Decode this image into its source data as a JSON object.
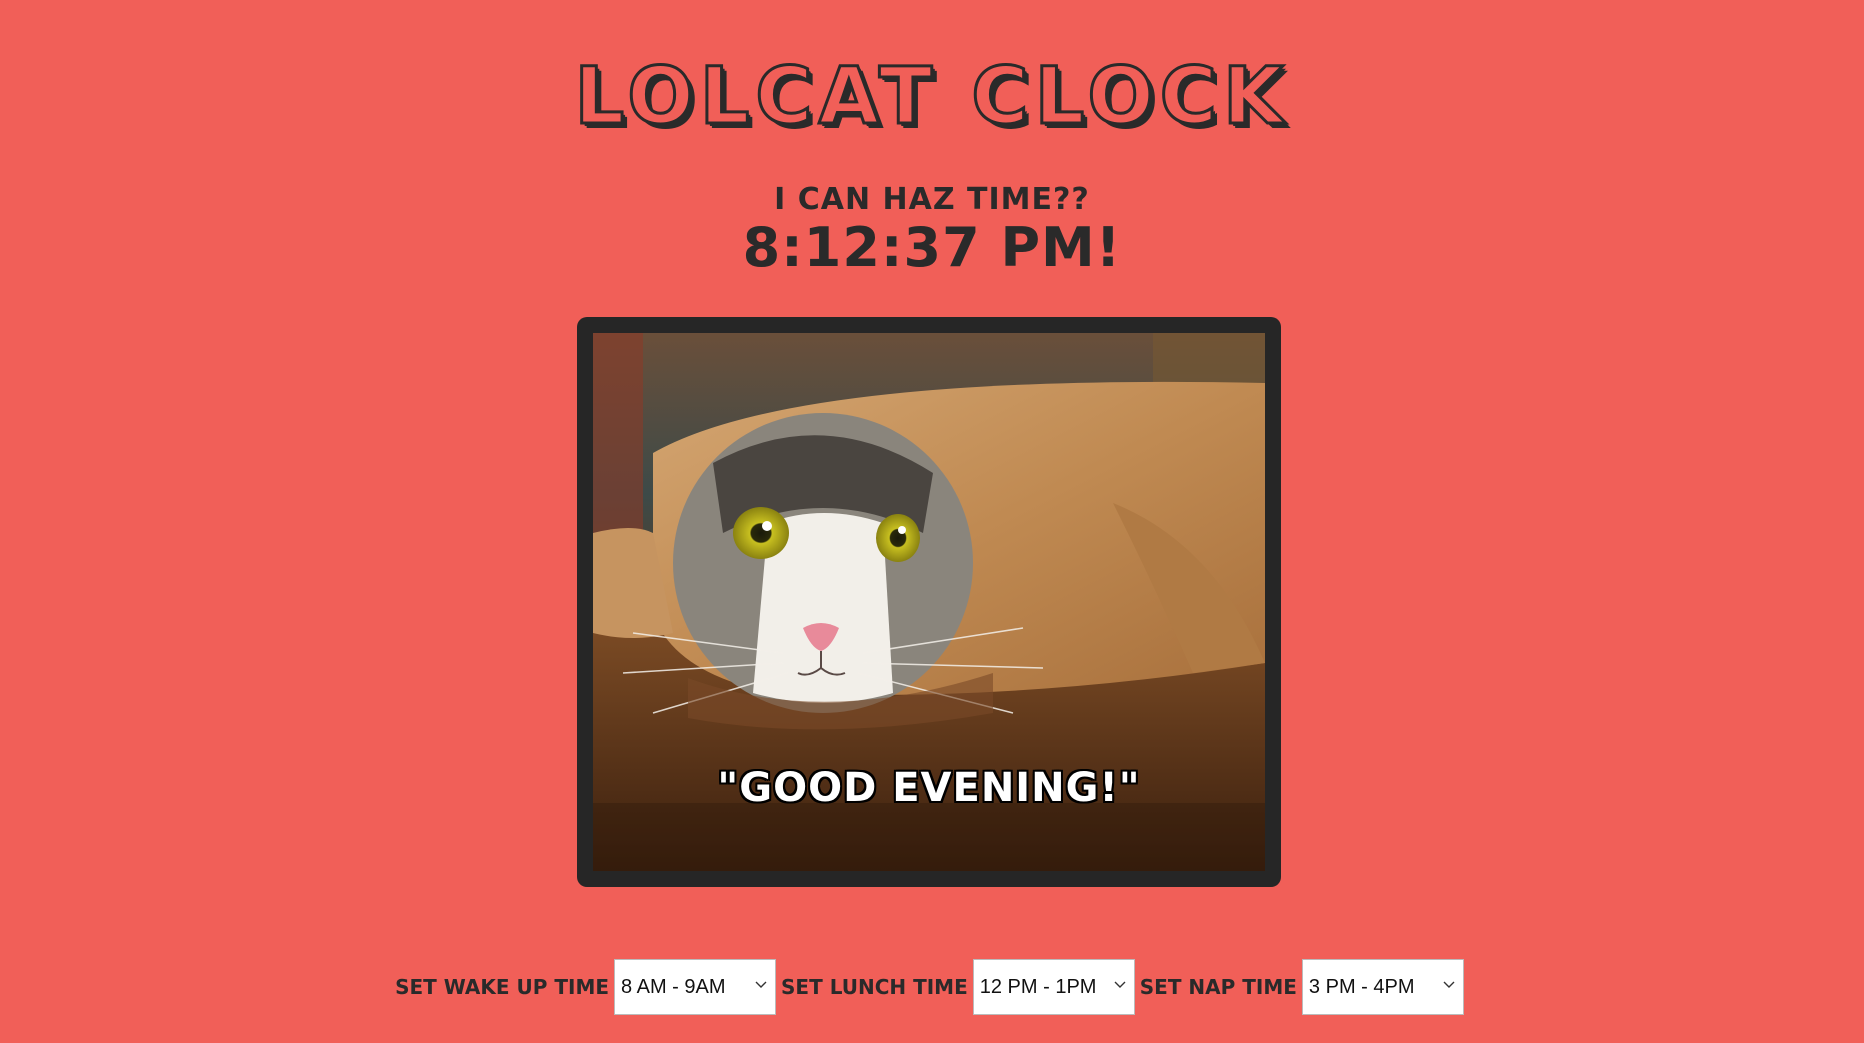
{
  "title": "LOLCAT CLOCK",
  "subtitle": "I CAN HAZ TIME??",
  "clock": "8:12:37 PM!",
  "image": {
    "caption": "\"GOOD EVENING!\""
  },
  "controls": {
    "wake": {
      "label": "SET WAKE UP TIME",
      "selected": "8 AM - 9AM",
      "icon": "chevron-down-icon"
    },
    "lunch": {
      "label": "SET LUNCH TIME",
      "selected": "12 PM - 1PM",
      "icon": "chevron-down-icon"
    },
    "nap": {
      "label": "SET NAP TIME",
      "selected": "3 PM - 4PM",
      "icon": "chevron-down-icon"
    }
  },
  "colors": {
    "background": "#f15f58",
    "text": "#2a2a2a",
    "frame": "#262626"
  }
}
